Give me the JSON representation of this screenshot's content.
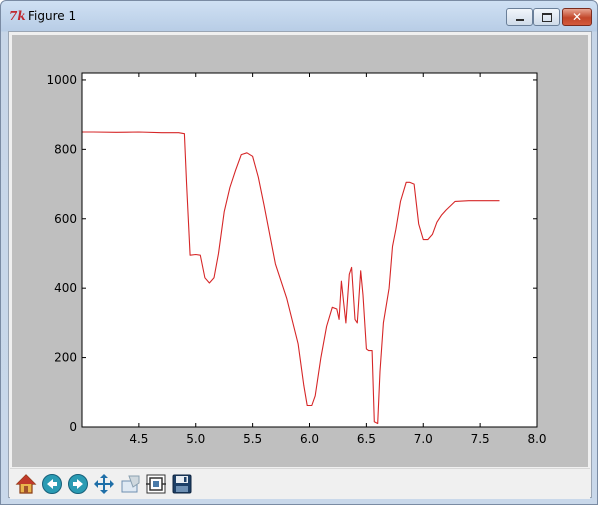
{
  "window": {
    "title": "Figure 1",
    "app_icon": "tk-feather-icon"
  },
  "toolbar": {
    "buttons": [
      {
        "name": "home-button",
        "icon": "home-icon"
      },
      {
        "name": "back-button",
        "icon": "back-arrow-icon"
      },
      {
        "name": "forward-button",
        "icon": "forward-arrow-icon"
      },
      {
        "name": "pan-button",
        "icon": "pan-arrows-icon"
      },
      {
        "name": "zoom-button",
        "icon": "zoom-rect-icon"
      },
      {
        "name": "subplots-button",
        "icon": "subplots-config-icon"
      },
      {
        "name": "save-button",
        "icon": "floppy-disk-icon"
      }
    ]
  },
  "colors": {
    "figure_background": "#bfbfbf",
    "axes_background": "#ffffff",
    "line": "#d62728"
  },
  "chart_data": {
    "type": "line",
    "title": "",
    "xlabel": "",
    "ylabel": "",
    "xlim": [
      4.0,
      8.0
    ],
    "ylim": [
      0,
      1020
    ],
    "xticks": [
      4.5,
      5.0,
      5.5,
      6.0,
      6.5,
      7.0,
      7.5,
      8.0
    ],
    "xtick_labels": [
      "4.5",
      "5.0",
      "5.5",
      "6.0",
      "6.5",
      "7.0",
      "7.5",
      "8.0"
    ],
    "yticks": [
      0,
      200,
      400,
      600,
      800,
      1000
    ],
    "ytick_labels": [
      "0",
      "200",
      "400",
      "600",
      "800",
      "1000"
    ],
    "grid": false,
    "series": [
      {
        "color": "#d62728",
        "x": [
          4.0,
          4.1,
          4.3,
          4.5,
          4.7,
          4.85,
          4.9,
          4.92,
          4.95,
          5.0,
          5.04,
          5.08,
          5.12,
          5.16,
          5.2,
          5.25,
          5.3,
          5.35,
          5.4,
          5.45,
          5.5,
          5.55,
          5.6,
          5.7,
          5.8,
          5.9,
          5.95,
          5.98,
          6.02,
          6.05,
          6.1,
          6.15,
          6.2,
          6.24,
          6.26,
          6.28,
          6.3,
          6.32,
          6.35,
          6.37,
          6.4,
          6.42,
          6.45,
          6.47,
          6.5,
          6.52,
          6.55,
          6.57,
          6.6,
          6.62,
          6.65,
          6.7,
          6.73,
          6.76,
          6.8,
          6.85,
          6.88,
          6.92,
          6.96,
          7.0,
          7.04,
          7.08,
          7.12,
          7.16,
          7.2,
          7.28,
          7.4,
          7.55,
          7.67
        ],
        "y": [
          850,
          850,
          849,
          850,
          848,
          848,
          845,
          700,
          495,
          497,
          495,
          430,
          415,
          430,
          500,
          620,
          690,
          740,
          785,
          790,
          780,
          720,
          640,
          470,
          370,
          240,
          120,
          62,
          62,
          90,
          200,
          290,
          345,
          340,
          310,
          420,
          360,
          300,
          440,
          460,
          310,
          300,
          450,
          380,
          225,
          220,
          220,
          15,
          10,
          160,
          300,
          400,
          520,
          570,
          650,
          705,
          705,
          700,
          585,
          540,
          540,
          555,
          590,
          610,
          625,
          650,
          652,
          652,
          652
        ]
      }
    ]
  }
}
